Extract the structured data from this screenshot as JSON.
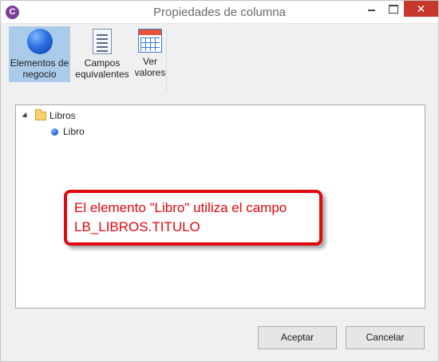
{
  "window": {
    "title": "Propiedades de columna",
    "app_icon_glyph": "C",
    "close_glyph": "✕"
  },
  "toolbar": {
    "items": [
      {
        "line1": "Elementos de",
        "line2": "negocio",
        "icon": "sphere-icon",
        "active": true
      },
      {
        "line1": "Campos",
        "line2": "equivalentes",
        "icon": "document-list-icon",
        "active": false
      },
      {
        "line1": "Ver",
        "line2": "valores",
        "icon": "calendar-grid-icon",
        "active": false
      }
    ]
  },
  "tree": {
    "root_label": "Libros",
    "child_label": "Libro"
  },
  "callout": {
    "line1": "El elemento \"Libro\" utiliza el campo",
    "line2": "LB_LIBROS.TITULO"
  },
  "buttons": {
    "ok": "Aceptar",
    "cancel": "Cancelar"
  },
  "colors": {
    "accent_selected": "#aacbea",
    "close_button": "#c7372c",
    "callout_red": "#e2070e"
  }
}
